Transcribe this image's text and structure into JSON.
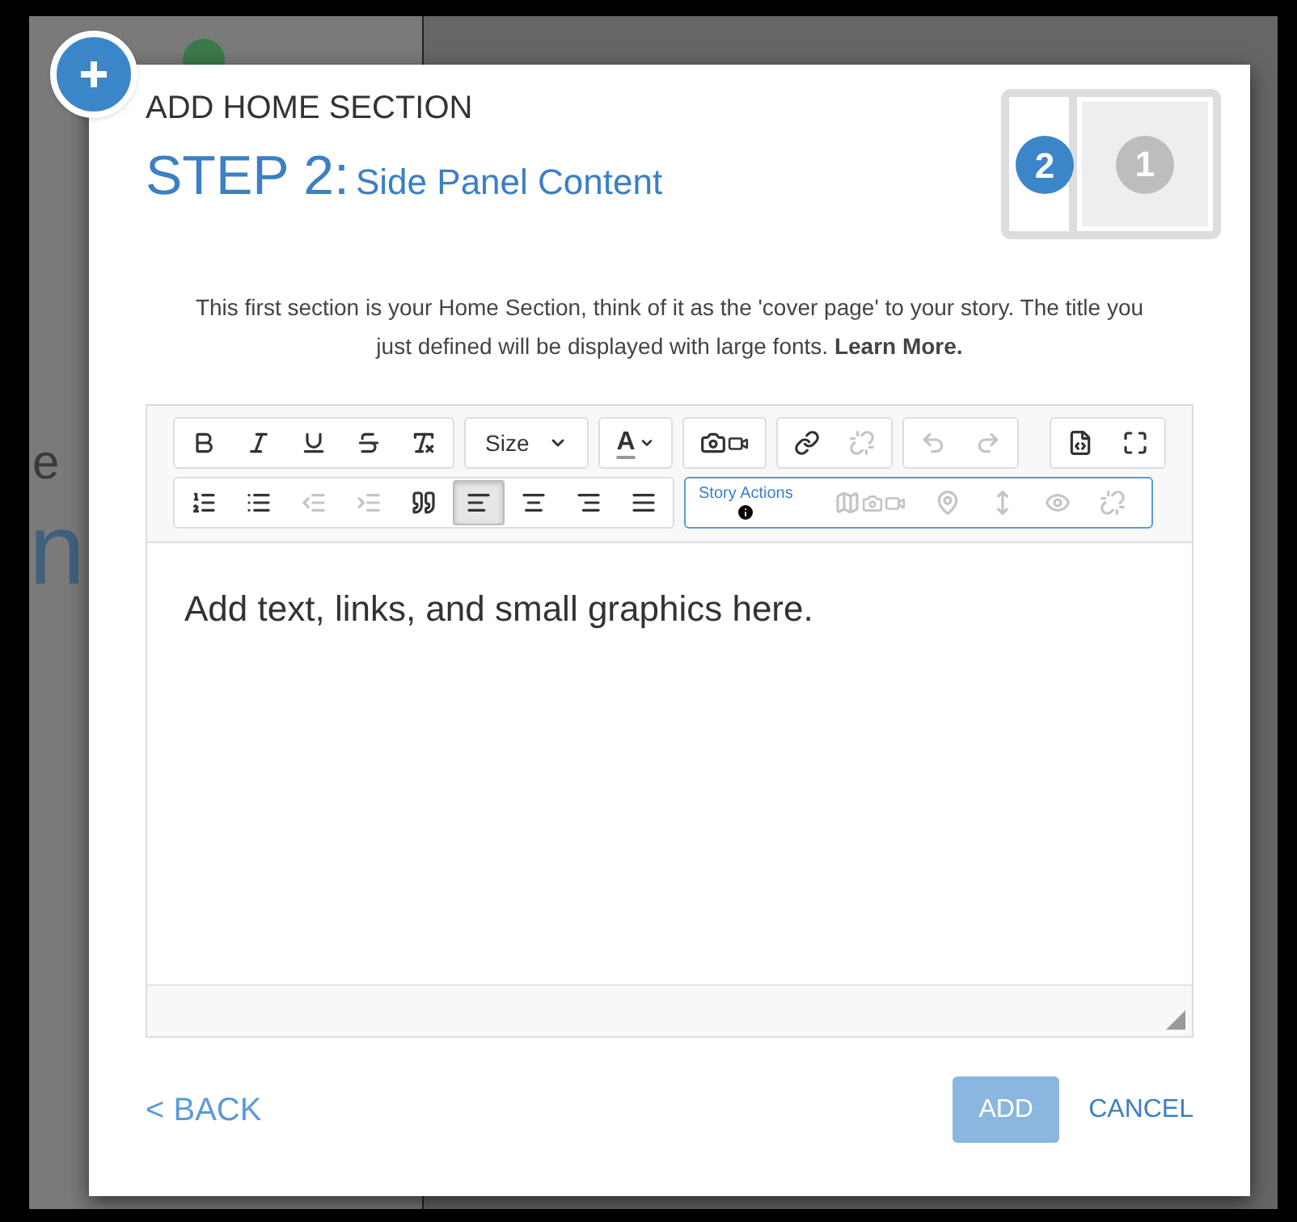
{
  "backdrop": {
    "fragments_left": [
      "e",
      "n"
    ]
  },
  "dialog": {
    "title": "ADD HOME SECTION",
    "step_label": "STEP 2:",
    "step_title": "Side Panel Content",
    "step_badges": [
      "2",
      "1"
    ],
    "description": "This first section is your Home Section, think of it as the 'cover page' to your story. The title you just defined will be displayed with large fonts. **Learn More.**"
  },
  "toolbar": {
    "rows": [
      [
        {
          "buttons": [
            {
              "disabled": false,
              "selected": false
            },
            {
              "disabled": false,
              "selected": false
            },
            {
              "disabled": false,
              "selected": false
            },
            {
              "disabled": false,
              "selected": false
            },
            {
              "disabled": false,
              "selected": false
            }
          ]
        },
        {
          "dropdown": "Size"
        },
        {
          "color_label": "A"
        },
        {
          "buttons": [
            {
              "disabled": false,
              "selected": false
            }
          ]
        },
        {
          "buttons": [
            {
              "disabled": false,
              "selected": false
            },
            {
              "disabled": true,
              "selected": false
            }
          ]
        },
        {
          "buttons": [
            {
              "disabled": true,
              "selected": false
            },
            {
              "disabled": true,
              "selected": false
            }
          ]
        },
        {
          "buttons": [
            {
              "disabled": false,
              "selected": false
            },
            {
              "disabled": false,
              "selected": false
            }
          ]
        }
      ],
      [
        {
          "buttons": [
            {
              "disabled": false,
              "selected": false
            },
            {
              "disabled": false,
              "selected": false
            },
            {
              "disabled": true,
              "selected": false
            },
            {
              "disabled": true,
              "selected": false
            },
            {
              "disabled": false,
              "selected": false
            },
            {
              "disabled": false,
              "selected": true
            },
            {
              "disabled": false,
              "selected": false
            },
            {
              "disabled": false,
              "selected": false
            },
            {
              "disabled": false,
              "selected": false
            }
          ]
        },
        {
          "label": "Story Actions",
          "buttons": [
            {
              "disabled": true,
              "selected": false
            },
            {
              "disabled": true,
              "selected": false
            },
            {
              "disabled": true,
              "selected": false
            },
            {
              "disabled": true,
              "selected": false
            },
            {
              "disabled": true,
              "selected": false
            }
          ]
        }
      ]
    ]
  },
  "editor": {
    "content": "Add text, links, and small graphics here."
  },
  "footer": {
    "back": "< BACK",
    "add": "ADD",
    "add_disabled": true,
    "cancel": "CANCEL"
  }
}
